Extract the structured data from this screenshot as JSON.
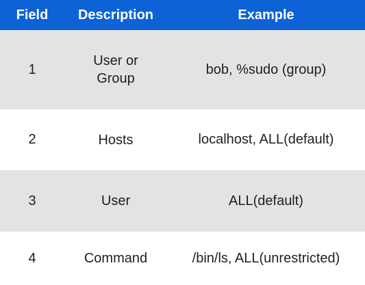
{
  "header": {
    "field": "Field",
    "description": "Description",
    "example": "Example"
  },
  "rows": [
    {
      "field": "1",
      "description": "User or\nGroup",
      "example": "bob, %sudo (group)"
    },
    {
      "field": "2",
      "description": "Hosts",
      "example": "localhost, ALL(default)"
    },
    {
      "field": "3",
      "description": "User",
      "example": "ALL(default)"
    },
    {
      "field": "4",
      "description": "Command",
      "example": "/bin/ls, ALL(unrestricted)"
    }
  ],
  "colors": {
    "header_bg": "#0d63d6",
    "shade_bg": "#e3e3e3",
    "plain_bg": "#ffffff"
  }
}
